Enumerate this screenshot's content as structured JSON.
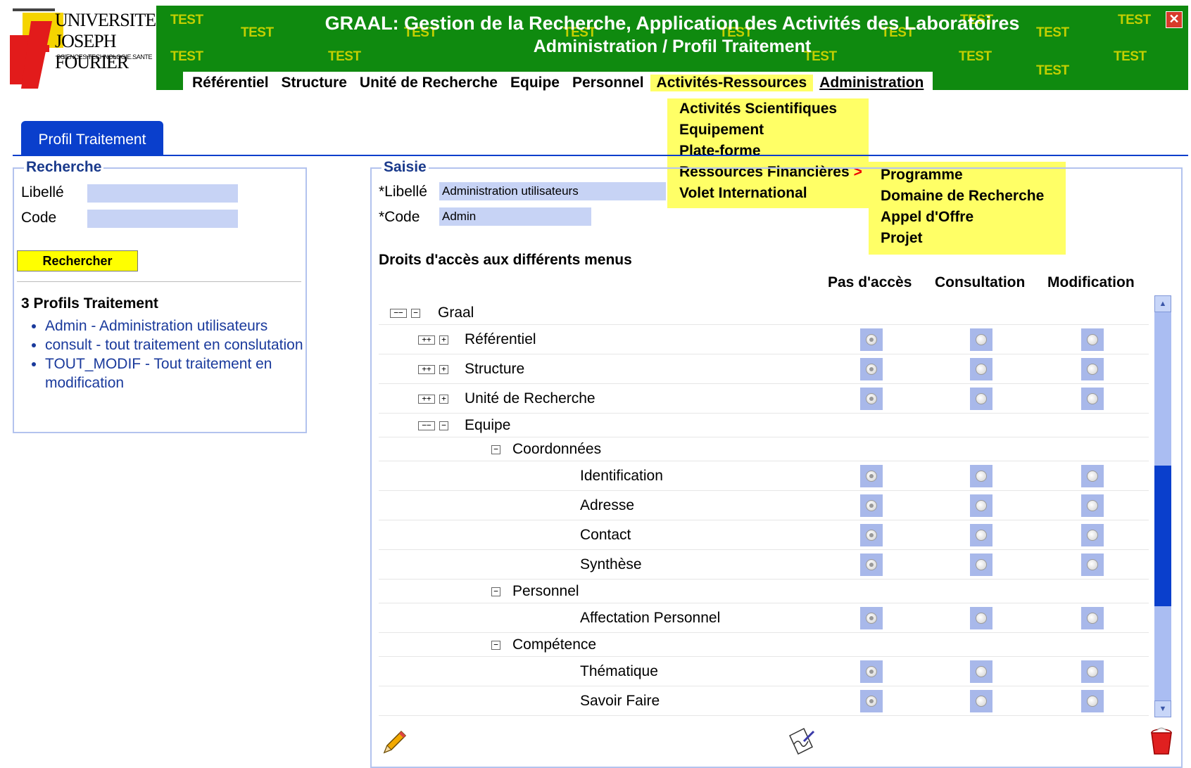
{
  "header": {
    "title_line1": "GRAAL: Gestion de la Recherche, Application des Activités des Laboratoires",
    "title_line2": "Administration / Profil Traitement",
    "test_mark": "TEST",
    "close_symbol": "✕"
  },
  "logo": {
    "line1": "UNIVERSITE",
    "line2": "JOSEPH FOURIER",
    "line3": "SCIENCES.TECHNOLOGIE.SANTE"
  },
  "menu": {
    "items": [
      "Référentiel",
      "Structure",
      "Unité de Recherche",
      "Equipe",
      "Personnel",
      "Activités-Ressources",
      "Administration"
    ]
  },
  "dropdown1": {
    "items": [
      "Activités Scientifiques",
      "Equipement",
      "Plate-forme",
      "Ressources Financières",
      "Volet International"
    ],
    "arrow": ">"
  },
  "dropdown2": {
    "items": [
      "Programme",
      "Domaine de Recherche",
      "Appel d'Offre",
      "Projet"
    ]
  },
  "tab": {
    "label": "Profil Traitement"
  },
  "recherche": {
    "legend": "Recherche",
    "libelle_label": "Libellé",
    "libelle_value": "",
    "code_label": "Code",
    "code_value": "",
    "button": "Rechercher",
    "results_title": "3 Profils Traitement",
    "results": [
      "Admin - Administration utilisateurs",
      "consult - tout traitement en conslutation",
      "TOUT_MODIF - Tout traitement en modification"
    ]
  },
  "saisie": {
    "legend": "Saisie",
    "libelle_label": "*Libellé",
    "libelle_value": "Administration utilisateurs",
    "code_label": "*Code",
    "code_value": "Admin",
    "rights_title": "Droits d'accès aux différents menus",
    "columns": [
      "Pas d'accès",
      "Consultation",
      "Modification"
    ]
  },
  "tree": [
    {
      "label": "Graal",
      "level": 0,
      "expander": "minus",
      "radios": false
    },
    {
      "label": "Référentiel",
      "level": 1,
      "expander": "plus",
      "radios": true,
      "selected": 0
    },
    {
      "label": "Structure",
      "level": 1,
      "expander": "plus",
      "radios": true,
      "selected": 0
    },
    {
      "label": "Unité de Recherche",
      "level": 1,
      "expander": "plus",
      "radios": true,
      "selected": 0
    },
    {
      "label": "Equipe",
      "level": 1,
      "expander": "minus",
      "radios": false
    },
    {
      "label": "Coordonnées",
      "level": 2,
      "expander": "minus-single",
      "radios": false
    },
    {
      "label": "Identification",
      "level": 3,
      "radios": true,
      "selected": 0
    },
    {
      "label": "Adresse",
      "level": 3,
      "radios": true,
      "selected": 0
    },
    {
      "label": "Contact",
      "level": 3,
      "radios": true,
      "selected": 0
    },
    {
      "label": "Synthèse",
      "level": 3,
      "radios": true,
      "selected": 0
    },
    {
      "label": "Personnel",
      "level": 2,
      "expander": "minus-single",
      "radios": false
    },
    {
      "label": "Affectation Personnel",
      "level": 3,
      "radios": true,
      "selected": 0
    },
    {
      "label": "Compétence",
      "level": 2,
      "expander": "minus-single",
      "radios": false
    },
    {
      "label": "Thématique",
      "level": 3,
      "radios": true,
      "selected": 0
    },
    {
      "label": "Savoir Faire",
      "level": 3,
      "radios": true,
      "selected": 0
    }
  ],
  "scroll": {
    "thumb_position": 0.62
  },
  "actions": {
    "edit_icon": "pencil-icon",
    "validate_icon": "sign-icon",
    "delete_icon": "trash-icon"
  },
  "colors": {
    "banner": "#0f8a0f",
    "menu_highlight": "#ffff66",
    "tab_blue": "#0a3fcc",
    "input_bg": "#c7d3f5",
    "button_yellow": "#ffff00"
  }
}
